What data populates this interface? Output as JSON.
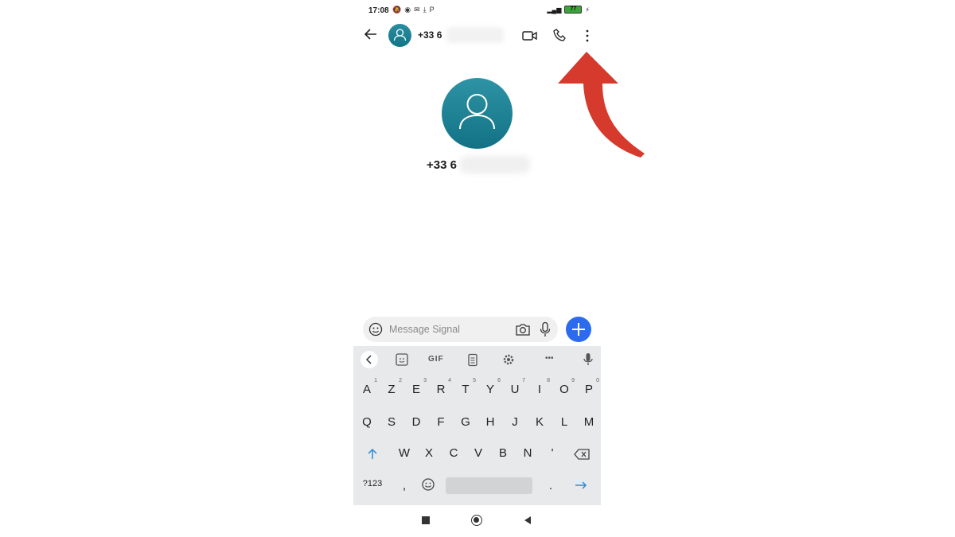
{
  "status_bar": {
    "time": "17:08",
    "icons": [
      "notification-off-icon",
      "messenger-icon",
      "mail-icon",
      "download-icon",
      "pinterest-icon"
    ],
    "battery_level": "77"
  },
  "header": {
    "contact_number": "+33 6",
    "icons": [
      "back-arrow-icon",
      "avatar-icon",
      "video-call-icon",
      "phone-icon",
      "more-vertical-icon"
    ]
  },
  "profile": {
    "number": "+33 6"
  },
  "compose": {
    "placeholder": "Message Signal"
  },
  "keyboard": {
    "toolbar": {
      "gif_label": "GIF",
      "more_label": "•••"
    },
    "row1": [
      {
        "k": "A",
        "n": "1"
      },
      {
        "k": "Z",
        "n": "2"
      },
      {
        "k": "E",
        "n": "3"
      },
      {
        "k": "R",
        "n": "4"
      },
      {
        "k": "T",
        "n": "5"
      },
      {
        "k": "Y",
        "n": "6"
      },
      {
        "k": "U",
        "n": "7"
      },
      {
        "k": "I",
        "n": "8"
      },
      {
        "k": "O",
        "n": "9"
      },
      {
        "k": "P",
        "n": "0"
      }
    ],
    "row2": [
      "Q",
      "S",
      "D",
      "F",
      "G",
      "H",
      "J",
      "K",
      "L",
      "M"
    ],
    "row3": [
      "W",
      "X",
      "C",
      "V",
      "B",
      "N",
      "'"
    ],
    "row4": {
      "symbols_label": "?123",
      "comma": ",",
      "period": "."
    }
  },
  "colors": {
    "accent": "#2c6bed",
    "avatar": "#1a7f92",
    "annotation_arrow": "#d63a2c"
  }
}
